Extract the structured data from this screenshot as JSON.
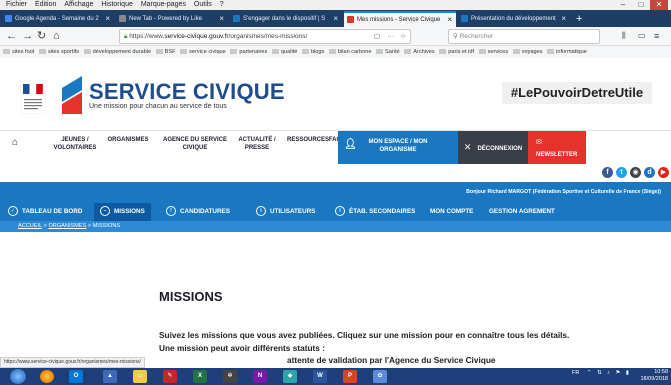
{
  "browser": {
    "menu": [
      "Fichier",
      "Édition",
      "Affichage",
      "Historique",
      "Marque-pages",
      "Outils",
      "?"
    ],
    "tabs": [
      {
        "label": "Google Agenda - Semaine du 2",
        "color": "#4285f4"
      },
      {
        "label": "New Tab - Powered by Like",
        "color": "#888888"
      },
      {
        "label": "S'engager dans le dispositif | S",
        "color": "#1a78c2"
      },
      {
        "label": "Mes missions - Service Civique",
        "color": "#e5322d",
        "active": true
      },
      {
        "label": "Présentation du développement",
        "color": "#1a78c2"
      }
    ],
    "url_prefix": "https://www.",
    "url_host": "service-civique.gouv.fr",
    "url_path": "/organismes/mes-missions/",
    "search_placeholder": "Rechercher",
    "bookmarks": [
      "sites foot",
      "sites sportifs",
      "développement durable",
      "BSF",
      "service civique",
      "partenaires",
      "qualité",
      "blogs",
      "bilan carbone",
      "Santé",
      "Archives",
      "paris et idf",
      "services",
      "voyages",
      "informatique"
    ],
    "status_url": "https://www.service-civique.gouv.fr/organismes/mes-missions/"
  },
  "site": {
    "logo_title": "SERVICE CIVIQUE",
    "logo_tagline": "Une mission pour chacun au service de tous",
    "hashtag": "#LePouvoirDetreUtile",
    "nav": [
      {
        "line1": "JEUNES /",
        "line2": "VOLONTAIRES"
      },
      {
        "line1": "ORGANISMES",
        "line2": ""
      },
      {
        "line1": "AGENCE DU SERVICE",
        "line2": "CIVIQUE"
      },
      {
        "line1": "ACTUALITÉ /",
        "line2": "PRESSE"
      },
      {
        "line1": "RESSOURCES",
        "line2": ""
      },
      {
        "line1": "FAQS",
        "line2": ""
      }
    ],
    "espace_line1": "MON ESPACE / MON",
    "espace_line2": "ORGANISME",
    "logout": "DÉCONNEXION",
    "newsletter": "NEWSLETTER",
    "greeting": "Bonjour Richard MARGOT (Fédération Sportive et Culturelle de France (Siège))",
    "dashboard_nav": [
      {
        "label": "TABLEAU DE BORD"
      },
      {
        "label": "MISSIONS",
        "active": true
      },
      {
        "label": "CANDIDATURES"
      },
      {
        "label": "UTILISATEURS"
      },
      {
        "label": "ÉTAB. SECONDAIRES"
      },
      {
        "label": "MON COMPTE"
      },
      {
        "label": "GESTION AGREMENT"
      }
    ],
    "breadcrumb": [
      "ACCUEIL",
      "ORGANISMES",
      "MISSIONS"
    ],
    "page_title": "MISSIONS",
    "intro": "Suivez les missions que vous avez publiées. Cliquez sur une mission pour en connaître tous les détails.",
    "status_intro": "Une mission peut avoir différents statuts :",
    "pending_fragment": "attente de validation par l'Agence du Service Civique"
  },
  "taskbar": {
    "apps": [
      "O",
      "X",
      "W",
      "N",
      "P"
    ],
    "tray": "FR",
    "time": "10:58",
    "date": "18/09/2018"
  }
}
